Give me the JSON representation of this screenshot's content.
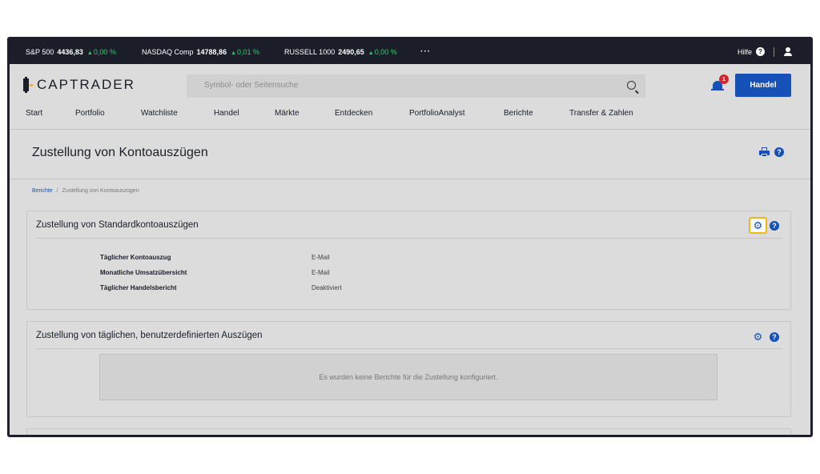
{
  "ticker": [
    {
      "name": "S&P 500",
      "value": "4436,83",
      "change": "0,00 %"
    },
    {
      "name": "NASDAQ Comp",
      "value": "14788,86",
      "change": "0,01 %"
    },
    {
      "name": "RUSSELL 1000",
      "value": "2490,65",
      "change": "0,00 %"
    }
  ],
  "ticker_more": "···",
  "help_label": "Hilfe",
  "logo_text": "CAPTRADER",
  "search": {
    "placeholder": "Symbol- oder Seitensuche"
  },
  "notifications": {
    "count": "1"
  },
  "trade_button": "Handel",
  "nav": [
    "Start",
    "Portfolio",
    "Watchliste",
    "Handel",
    "Märkte",
    "Entdecken",
    "PortfolioAnalyst",
    "Berichte",
    "Transfer & Zahlen"
  ],
  "page_title": "Zustellung von Kontoauszügen",
  "breadcrumb": {
    "link": "Berichte",
    "separator": "/",
    "current": "Zustellung von Kontoauszügen"
  },
  "standard_panel": {
    "title": "Zustellung von Standardkontoauszügen",
    "rows": [
      {
        "label": "Täglicher Kontoauszug",
        "value": "E-Mail"
      },
      {
        "label": "Monatliche Umsatzübersicht",
        "value": "E-Mail"
      },
      {
        "label": "Täglicher Handelsbericht",
        "value": "Deaktiviert"
      }
    ]
  },
  "custom_panel": {
    "title": "Zustellung von täglichen, benutzerdefinierten Auszügen",
    "empty_message": "Es wurden keine Berichte für die Zustellung konfiguriert."
  },
  "icons": {
    "help_glyph": "?",
    "gear_glyph": "⚙",
    "up_triangle": "▲"
  },
  "colors": {
    "accent": "#1551b6",
    "positive": "#2ecc71",
    "highlight": "#f2b51d",
    "badge": "#d9222a"
  }
}
